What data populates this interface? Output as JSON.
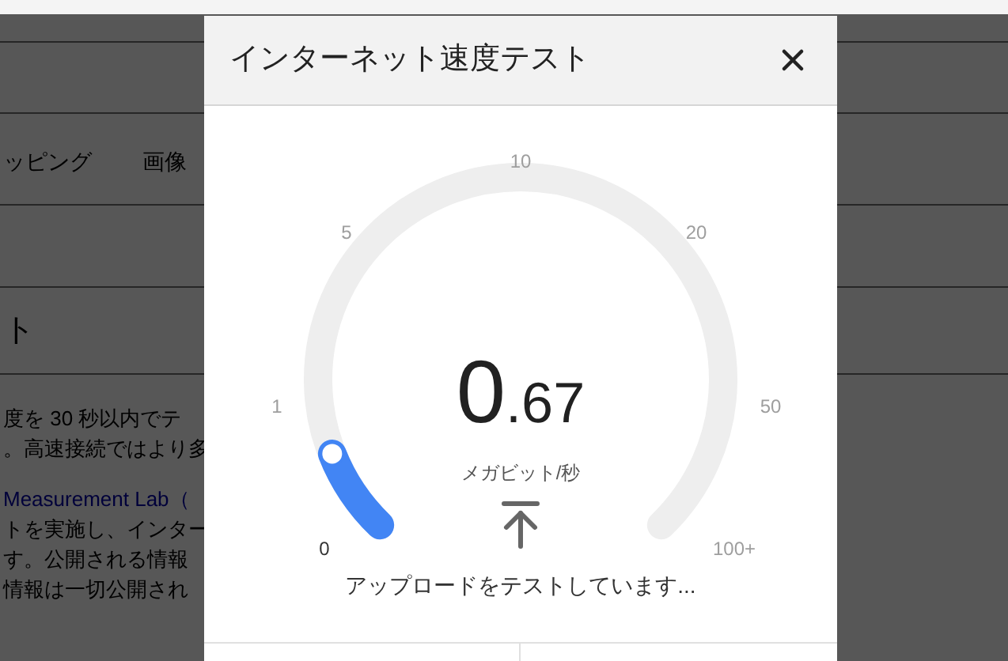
{
  "background_page": {
    "tabs": [
      "ッピング",
      "画像"
    ],
    "heading": "ト",
    "paragraph_lines": [
      {
        "kind": "text",
        "text": "度を 30 秒以内でテ"
      },
      {
        "kind": "text",
        "text": "。高速接続ではより多"
      },
      {
        "kind": "link",
        "text": "Measurement Lab（"
      },
      {
        "kind": "text",
        "text": "トを実施し、インター"
      },
      {
        "kind": "text",
        "text": "す。公開される情報"
      },
      {
        "kind": "text",
        "text": "情報は一切公開され"
      }
    ]
  },
  "dialog": {
    "title": "インターネット速度テスト",
    "gauge": {
      "ticks": [
        "0",
        "1",
        "5",
        "10",
        "20",
        "50",
        "100+"
      ],
      "level": 0.09,
      "value_whole": "0",
      "value_fraction": ".67",
      "unit": "メガビット/秒"
    },
    "status": "アップロードをテストしています..."
  }
}
